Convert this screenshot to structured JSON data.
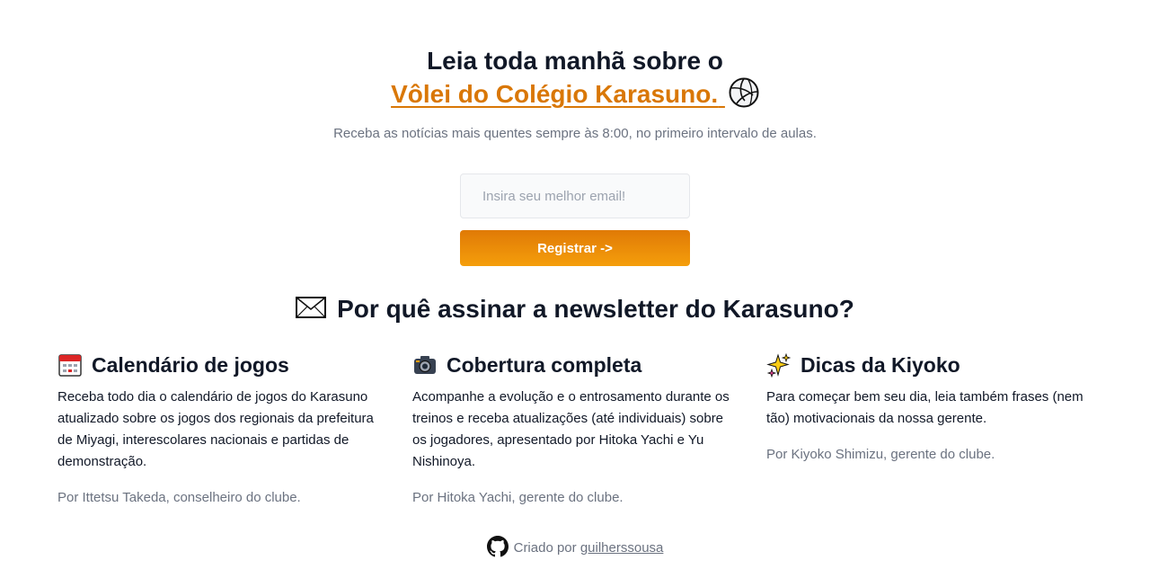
{
  "hero": {
    "line1": "Leia toda manhã sobre o",
    "line2": "Vôlei do Colégio Karasuno.",
    "icon": "volleyball-icon",
    "accent_color": "#d97706"
  },
  "subtitle": "Receba as notícias mais quentes sempre às 8:00, no primeiro intervalo de aulas.",
  "signup": {
    "email_placeholder": "Insira seu melhor email!",
    "email_value": "",
    "button_label": "Registrar ->"
  },
  "why": {
    "title": "Por quê assinar a newsletter do Karasuno?",
    "icon": "envelope-icon"
  },
  "features": [
    {
      "icon": "calendar-icon",
      "title": "Calendário de jogos",
      "description": "Receba todo dia o calendário de jogos do Karasuno atualizado sobre os jogos dos regionais da prefeitura de Miyagi, interescolares nacionais e partidas de demonstração.",
      "byline": "Por Ittetsu Takeda, conselheiro do clube."
    },
    {
      "icon": "camera-icon",
      "title": "Cobertura completa",
      "description": "Acompanhe a evolução e o entrosamento durante os treinos e receba atualizações (até individuais) sobre os jogadores, apresentado por Hitoka Yachi e Yu Nishinoya.",
      "byline": "Por Hitoka Yachi, gerente do clube."
    },
    {
      "icon": "sparkles-icon",
      "title": "Dicas da Kiyoko",
      "description": "Para começar bem seu dia, leia também frases (nem tão) motivacionais da nossa gerente.",
      "byline": "Por Kiyoko Shimizu, gerente do clube."
    }
  ],
  "footer": {
    "icon": "github-icon",
    "prefix": "Criado por",
    "author": "guilherssousa"
  }
}
